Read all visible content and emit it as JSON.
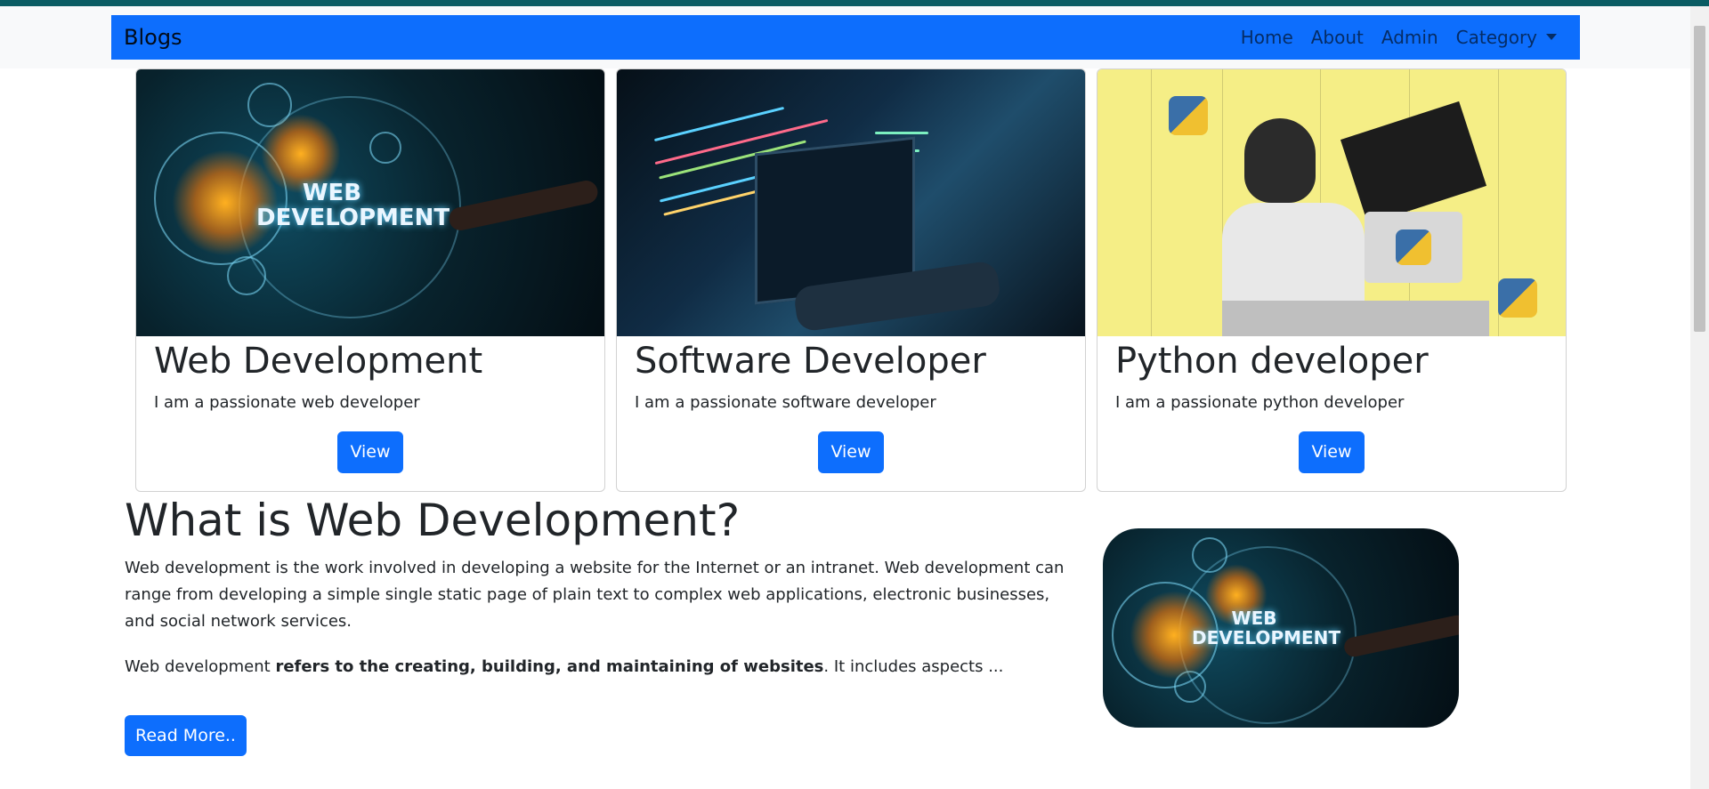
{
  "navbar": {
    "brand": "Blogs",
    "links": [
      "Home",
      "About",
      "Admin"
    ],
    "dropdown": "Category"
  },
  "cards": [
    {
      "title": "Web Development",
      "text": "I am a passionate web developer",
      "button": "View",
      "image_label": "WEB DEVELOPMENT"
    },
    {
      "title": "Software Developer",
      "text": "I am a passionate software developer",
      "button": "View"
    },
    {
      "title": "Python developer",
      "text": "I am a passionate python developer",
      "button": "View"
    }
  ],
  "article": {
    "title": "What is Web Development?",
    "para1": "Web development is the work involved in developing a website for the Internet or an intranet. Web development can range from developing a simple single static page of plain text to complex web applications, electronic businesses, and social network services.",
    "para2_start": "Web development ",
    "para2_bold": "refers to the creating, building, and maintaining of websites",
    "para2_end": ". It includes aspects ...",
    "button": "Read More..",
    "image_label": "WEB DEVELOPMENT"
  },
  "colors": {
    "primary": "#0d6efd",
    "accent_strip": "#0a5c63"
  }
}
